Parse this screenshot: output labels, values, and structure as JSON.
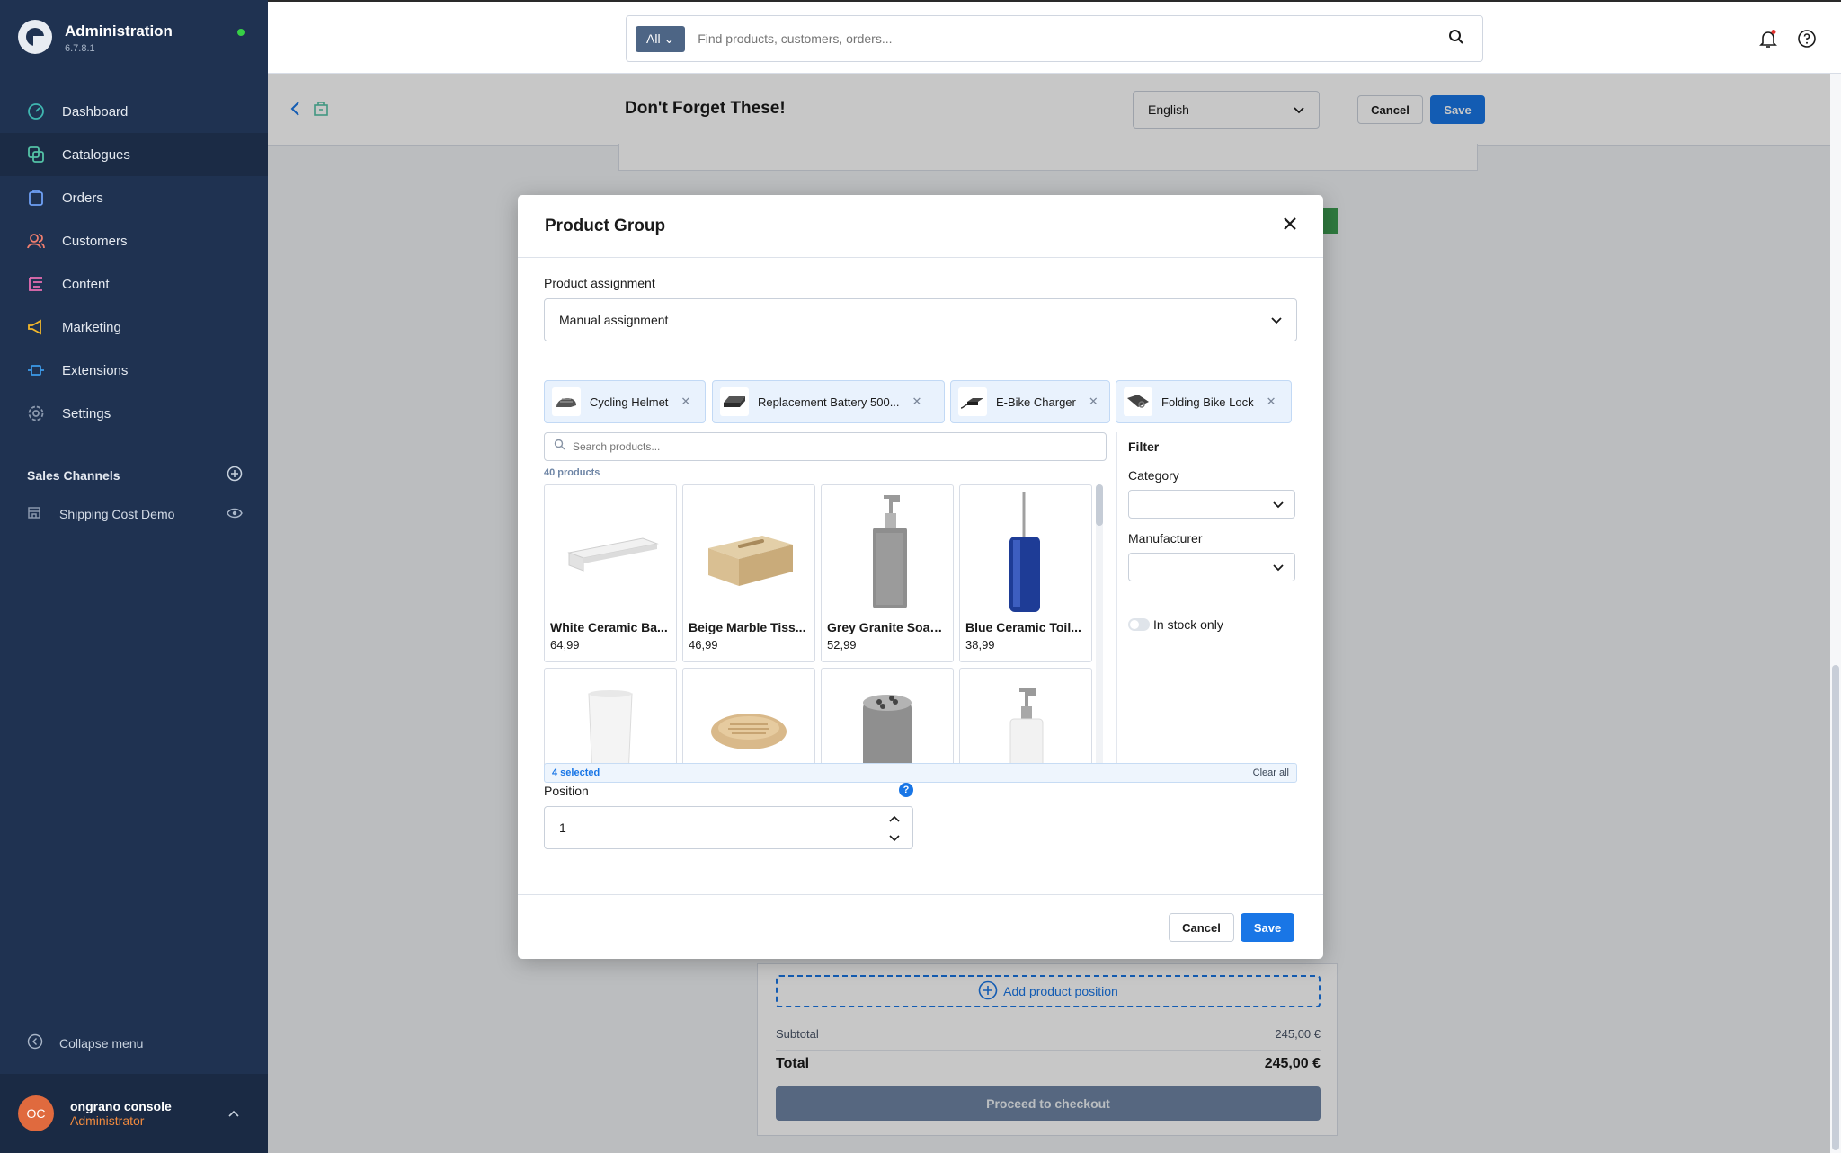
{
  "brand": {
    "title": "Administration",
    "version": "6.7.8.1"
  },
  "nav": [
    {
      "label": "Dashboard",
      "icon": "dashboard-icon",
      "color": "#3fb6b0"
    },
    {
      "label": "Catalogues",
      "icon": "catalogue-icon",
      "color": "#54c2a6"
    },
    {
      "label": "Orders",
      "icon": "orders-icon",
      "color": "#6ea0f5"
    },
    {
      "label": "Customers",
      "icon": "customers-icon",
      "color": "#f07e6e"
    },
    {
      "label": "Content",
      "icon": "content-icon",
      "color": "#e96db3"
    },
    {
      "label": "Marketing",
      "icon": "marketing-icon",
      "color": "#f2b72a"
    },
    {
      "label": "Extensions",
      "icon": "extensions-icon",
      "color": "#3d9bea"
    },
    {
      "label": "Settings",
      "icon": "settings-icon",
      "color": "#8a98ad"
    }
  ],
  "sales_channels": {
    "header": "Sales Channels",
    "items": [
      {
        "label": "Shipping Cost Demo"
      }
    ]
  },
  "collapse_label": "Collapse menu",
  "user": {
    "initials": "OC",
    "name": "ongrano console",
    "role": "Administrator"
  },
  "search": {
    "scope": "All",
    "placeholder": "Find products, customers, orders..."
  },
  "page": {
    "title": "Don't Forget These!",
    "language": "English",
    "cancel": "Cancel",
    "save": "Save"
  },
  "modal": {
    "title": "Product Group",
    "assignment_label": "Product assignment",
    "assignment_value": "Manual assignment",
    "chips": [
      {
        "label": "Cycling Helmet"
      },
      {
        "label": "Replacement Battery 500..."
      },
      {
        "label": "E-Bike Charger"
      },
      {
        "label": "Folding Bike Lock"
      }
    ],
    "product_search_placeholder": "Search products...",
    "product_count": "40 products",
    "products": [
      {
        "name": "White Ceramic Ba...",
        "price": "64,99"
      },
      {
        "name": "Beige Marble Tiss...",
        "price": "46,99"
      },
      {
        "name": "Grey Granite Soap...",
        "price": "52,99"
      },
      {
        "name": "Blue Ceramic Toil...",
        "price": "38,99"
      },
      {
        "name": "",
        "price": ""
      },
      {
        "name": "",
        "price": ""
      },
      {
        "name": "",
        "price": ""
      },
      {
        "name": "",
        "price": ""
      }
    ],
    "filter": {
      "title": "Filter",
      "category_label": "Category",
      "manufacturer_label": "Manufacturer",
      "in_stock_label": "In stock only"
    },
    "selected_text": "4 selected",
    "clear_all": "Clear all",
    "position_label": "Position",
    "position_value": "1",
    "cancel": "Cancel",
    "save": "Save"
  },
  "cart": {
    "add_position": "Add product position",
    "subtotal_label": "Subtotal",
    "subtotal_value": "245,00 €",
    "total_label": "Total",
    "total_value": "245,00 €",
    "checkout": "Proceed to checkout"
  }
}
